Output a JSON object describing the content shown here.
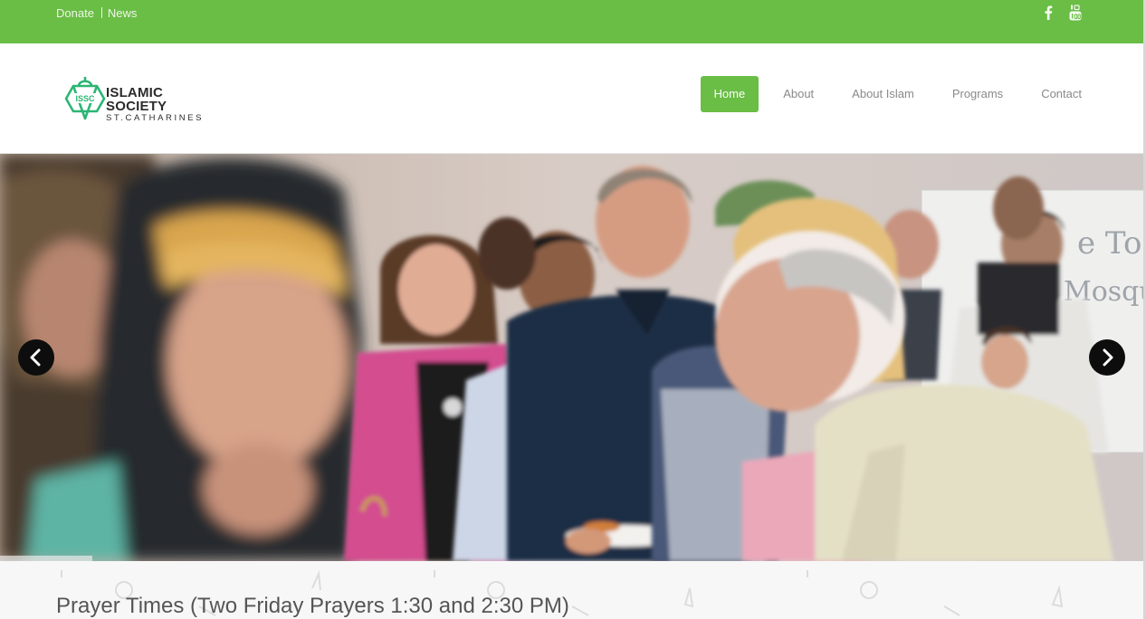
{
  "topbar": {
    "links": [
      "Donate",
      "News"
    ],
    "social_icons": [
      "facebook-icon",
      "youtube-icon"
    ],
    "color": "#6abd45"
  },
  "logo": {
    "badge": "ISSC",
    "line1": "ISLAMIC SOCIETY",
    "line2": "ST.CATHARINES",
    "color": "#2bb673"
  },
  "nav": {
    "items": [
      "Home",
      "About",
      "About Islam",
      "Programs",
      "Contact"
    ],
    "active": "Home"
  },
  "hero": {
    "prev_icon": "chevron-left-icon",
    "next_icon": "chevron-right-icon",
    "board_text": [
      "e To",
      "Mosque"
    ]
  },
  "prayer": {
    "heading": "Prayer Times (Two Friday Prayers 1:30 and 2:30 PM)"
  }
}
